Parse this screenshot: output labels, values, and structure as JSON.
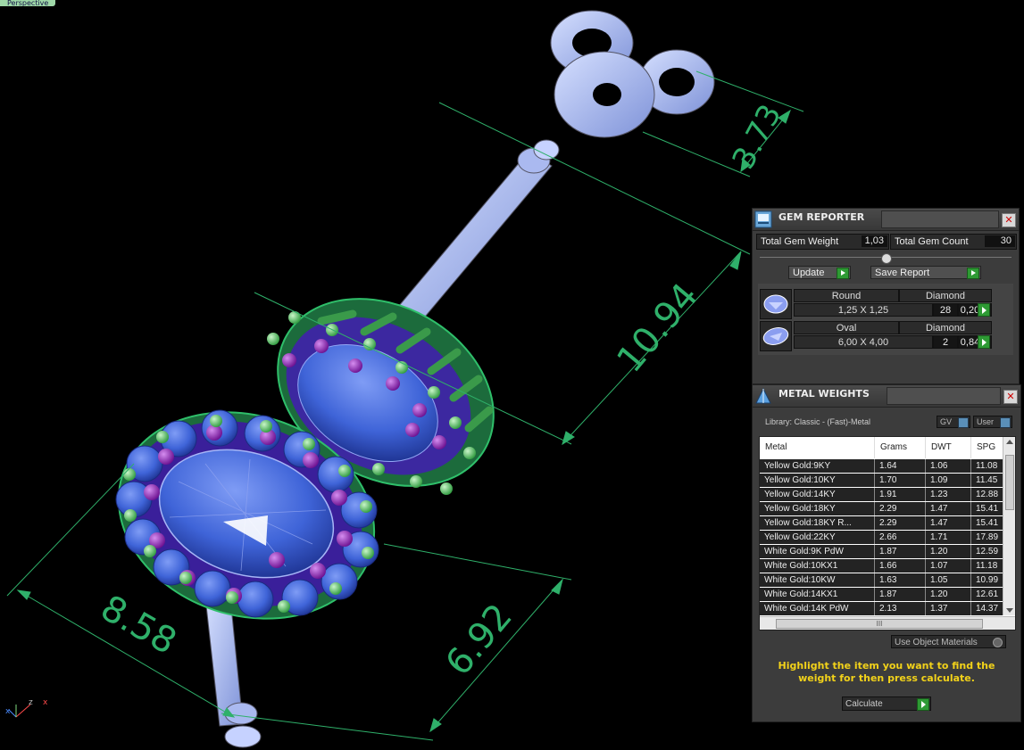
{
  "viewport": {
    "label": "Perspective",
    "dimensions": [
      "3.73",
      "10.94",
      "8.58",
      "6.92"
    ],
    "axis_labels": [
      "x",
      "z",
      "x"
    ],
    "colors": {
      "metal": "#9fb2ee",
      "stone": "#3f64d8",
      "prong": "#8d1fb1",
      "bead": "#5bc76a",
      "dimension": "#2fb06a"
    }
  },
  "gem_reporter": {
    "title": "GEM REPORTER",
    "total_weight_label": "Total Gem Weight",
    "total_weight_value": "1,03",
    "total_count_label": "Total Gem Count",
    "total_count_value": "30",
    "update_label": "Update",
    "save_report_label": "Save Report",
    "gems": [
      {
        "shape": "Round",
        "material": "Diamond",
        "size": "1,25 X 1,25",
        "count": "28",
        "weight": "0,20tw"
      },
      {
        "shape": "Oval",
        "material": "Diamond",
        "size": "6,00 X 4,00",
        "count": "2",
        "weight": "0,84tw"
      }
    ]
  },
  "metal_weights": {
    "title": "METAL WEIGHTS",
    "library": "Library: Classic - (Fast)-Metal",
    "gv_label": "GV",
    "user_label": "User",
    "columns": [
      "Metal",
      "Grams",
      "DWT",
      "SPG"
    ],
    "rows": [
      [
        "Yellow Gold:9KY",
        "1.64",
        "1.06",
        "11.08"
      ],
      [
        "Yellow Gold:10KY",
        "1.70",
        "1.09",
        "11.45"
      ],
      [
        "Yellow Gold:14KY",
        "1.91",
        "1.23",
        "12.88"
      ],
      [
        "Yellow Gold:18KY",
        "2.29",
        "1.47",
        "15.41"
      ],
      [
        "Yellow Gold:18KY R...",
        "2.29",
        "1.47",
        "15.41"
      ],
      [
        "Yellow Gold:22KY",
        "2.66",
        "1.71",
        "17.89"
      ],
      [
        "White Gold:9K PdW",
        "1.87",
        "1.20",
        "12.59"
      ],
      [
        "White Gold:10KX1",
        "1.66",
        "1.07",
        "11.18"
      ],
      [
        "White Gold:10KW",
        "1.63",
        "1.05",
        "10.99"
      ],
      [
        "White Gold:14KX1",
        "1.87",
        "1.20",
        "12.61"
      ],
      [
        "White Gold:14K PdW",
        "2.13",
        "1.37",
        "14.37"
      ]
    ],
    "scroll_label": "III",
    "use_object_materials": "Use Object Materials",
    "hint": "Highlight the item you want to find the weight for then press calculate.",
    "calculate_label": "Calculate"
  }
}
